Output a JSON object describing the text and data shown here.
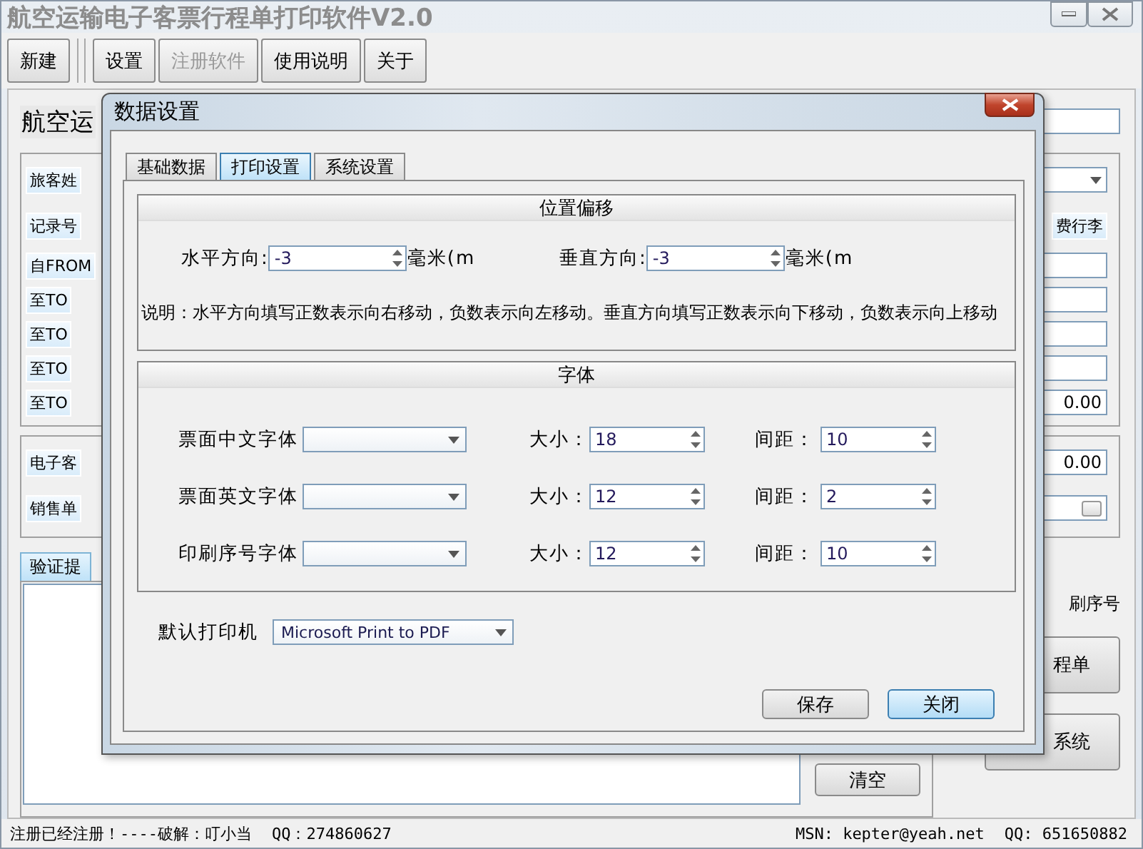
{
  "window": {
    "title": "航空运输电子客票行程单打印软件V2.0"
  },
  "toolbar": [
    {
      "label": "新建",
      "disabled": false
    },
    {
      "label": "设置",
      "disabled": false
    },
    {
      "label": "注册软件",
      "disabled": true
    },
    {
      "label": "使用说明",
      "disabled": false
    },
    {
      "label": "关于",
      "disabled": false
    }
  ],
  "main": {
    "heading": "航空运",
    "passenger_rows": [
      {
        "label": "旅客姓",
        "right": {
          "kind": "select"
        }
      },
      {
        "label": "记录号",
        "right": {
          "kind": "text",
          "text": "费行李"
        }
      },
      {
        "label": "自FROM",
        "right": {
          "kind": "field"
        }
      },
      {
        "label": "至TO",
        "right": {
          "kind": "field"
        }
      },
      {
        "label": "至TO",
        "right": {
          "kind": "field"
        }
      },
      {
        "label": "至TO",
        "right": {
          "kind": "field"
        }
      },
      {
        "label": "至TO",
        "right": {
          "kind": "field",
          "value": "0.00"
        }
      }
    ],
    "ticket_rows": [
      {
        "label": "电子客",
        "right": {
          "kind": "field",
          "value": "0.00"
        }
      },
      {
        "label": "销售单",
        "right": {
          "kind": "picker"
        }
      }
    ],
    "verify_tab": "验证提",
    "clear_button": "清空",
    "serial_label": "刷序号",
    "side_buttons": [
      "程单",
      "系统"
    ]
  },
  "dialog": {
    "title": "数据设置",
    "tabs": [
      {
        "label": "基础数据",
        "selected": false
      },
      {
        "label": "打印设置",
        "selected": true
      },
      {
        "label": "系统设置",
        "selected": false
      }
    ],
    "offset_group": {
      "title": "位置偏移",
      "fields": [
        {
          "label": "水平方向:",
          "value": "-3",
          "unit": "毫米(m"
        },
        {
          "label": "垂直方向:",
          "value": "-3",
          "unit": "毫米(m"
        }
      ],
      "note": "说明：水平方向填写正数表示向右移动，负数表示向左移动。垂直方向填写正数表示向下移动，负数表示向上移动"
    },
    "font_group": {
      "title": "字体",
      "rows": [
        {
          "label": "票面中文字体",
          "size_label": "大小：",
          "size": "18",
          "spacing_label": "间距：",
          "spacing": "10"
        },
        {
          "label": "票面英文字体",
          "size_label": "大小：",
          "size": "12",
          "spacing_label": "间距：",
          "spacing": "2"
        },
        {
          "label": "印刷序号字体",
          "size_label": "大小：",
          "size": "12",
          "spacing_label": "间距：",
          "spacing": "10"
        }
      ]
    },
    "printer": {
      "label": "默认打印机",
      "value": "Microsoft Print to PDF"
    },
    "buttons": [
      {
        "label": "保存",
        "default": false
      },
      {
        "label": "关闭",
        "default": true
      }
    ]
  },
  "status_bar": {
    "left": [
      "注册已经注册！----破解：叮小当",
      "QQ：274860627"
    ],
    "right": [
      "MSN: kepter@yeah.net",
      "QQ: 651650882"
    ]
  }
}
